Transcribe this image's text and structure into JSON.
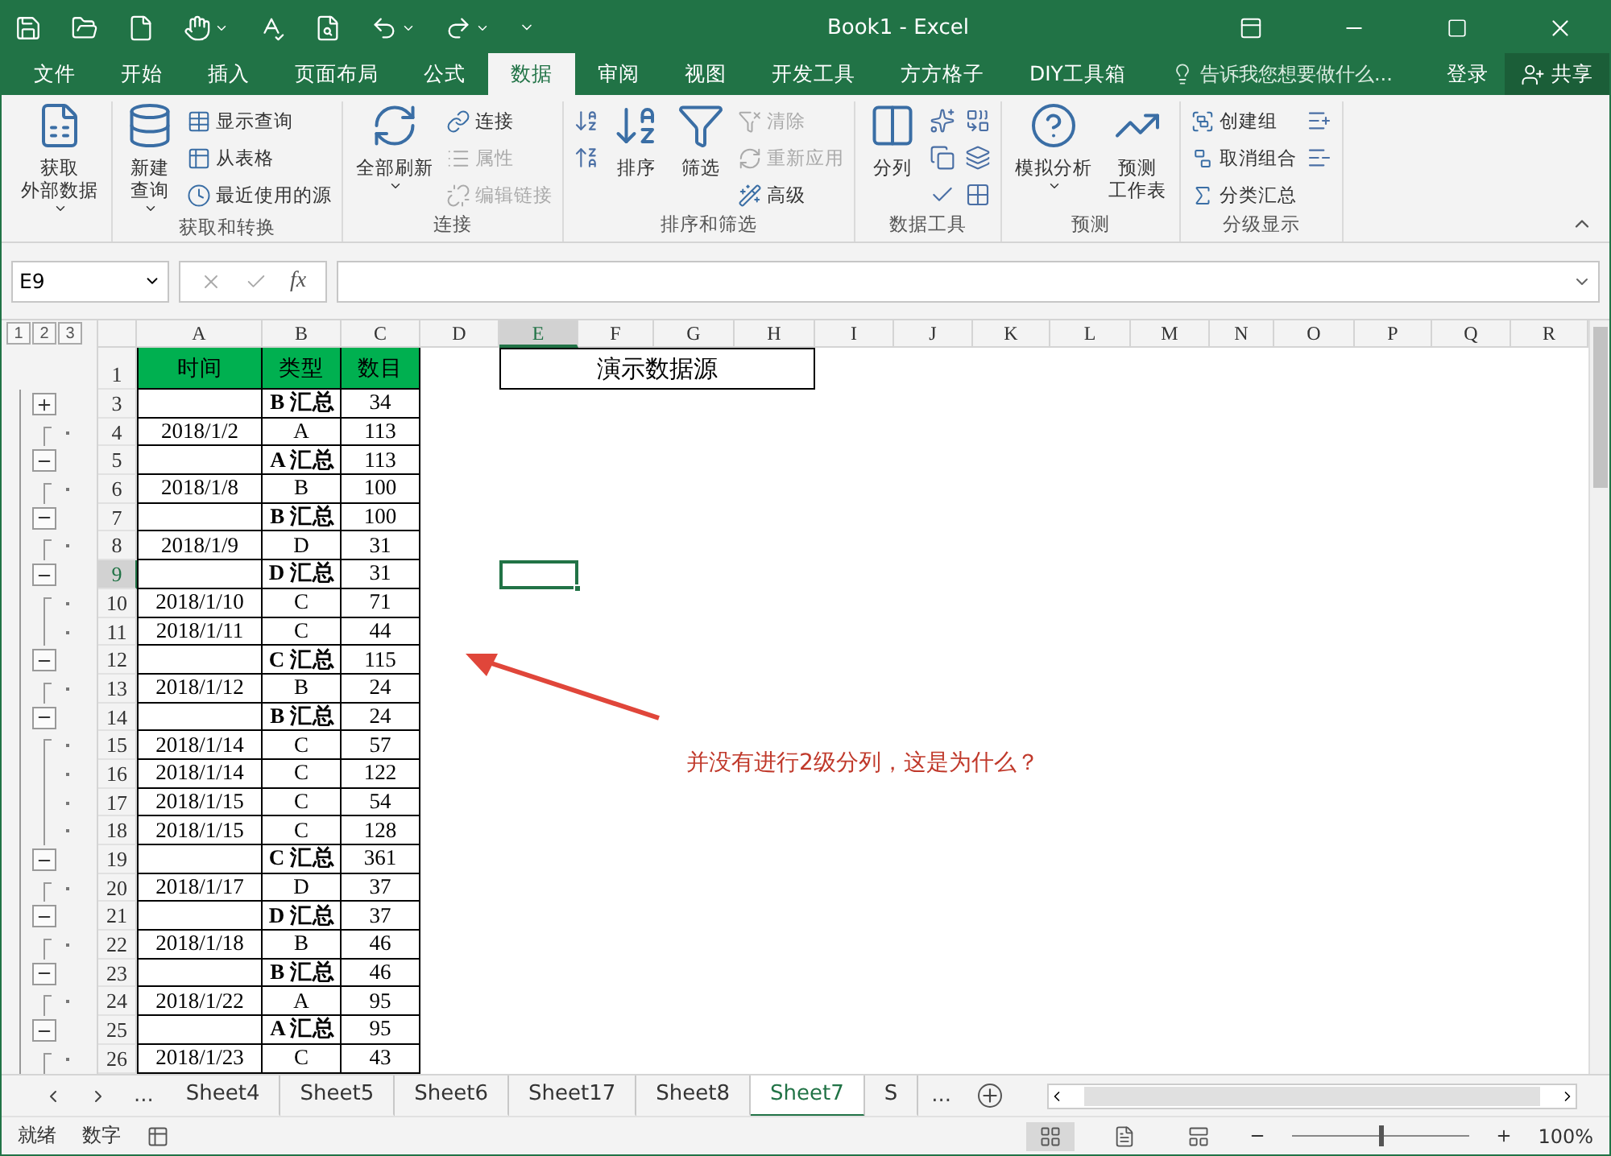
{
  "window": {
    "title": "Book1 - Excel"
  },
  "menu_tabs": [
    {
      "label": "文件",
      "selected": false
    },
    {
      "label": "开始",
      "selected": false
    },
    {
      "label": "插入",
      "selected": false
    },
    {
      "label": "页面布局",
      "selected": false
    },
    {
      "label": "公式",
      "selected": false
    },
    {
      "label": "数据",
      "selected": true
    },
    {
      "label": "审阅",
      "selected": false
    },
    {
      "label": "视图",
      "selected": false
    },
    {
      "label": "开发工具",
      "selected": false
    },
    {
      "label": "方方格子",
      "selected": false
    },
    {
      "label": "DIY工具箱",
      "selected": false
    }
  ],
  "tell_me": {
    "placeholder": "告诉我您想要做什么..."
  },
  "sign_in": "登录",
  "share": "共享",
  "ribbon_groups": [
    {
      "items": [
        {
          "kind": "large",
          "lines": [
            "获取",
            "外部数据"
          ],
          "dropdown": true,
          "disabled": false
        }
      ]
    },
    {
      "label": "获取和转换",
      "items": [
        {
          "kind": "large",
          "lines": [
            "新建",
            "查询"
          ],
          "dropdown": true,
          "disabled": false
        },
        {
          "kind": "small",
          "label": "显示查询",
          "disabled": false
        },
        {
          "kind": "small",
          "label": "从表格",
          "disabled": false
        },
        {
          "kind": "small",
          "label": "最近使用的源",
          "disabled": false
        }
      ]
    },
    {
      "label": "连接",
      "items": [
        {
          "kind": "large",
          "lines": [
            "全部刷新"
          ],
          "dropdown": true,
          "disabled": false
        },
        {
          "kind": "small",
          "label": "连接",
          "disabled": false
        },
        {
          "kind": "small",
          "label": "属性",
          "disabled": true
        },
        {
          "kind": "small",
          "label": "编辑链接",
          "disabled": true
        }
      ]
    },
    {
      "label": "排序和筛选",
      "items": [
        {
          "kind": "icons"
        },
        {
          "kind": "large",
          "lines": [
            "排序"
          ],
          "dropdown": false,
          "disabled": false
        },
        {
          "kind": "large",
          "lines": [
            "筛选"
          ],
          "dropdown": false,
          "disabled": false
        },
        {
          "kind": "small",
          "label": "清除",
          "disabled": true
        },
        {
          "kind": "small",
          "label": "重新应用",
          "disabled": true
        },
        {
          "kind": "small",
          "label": "高级",
          "disabled": false
        }
      ]
    },
    {
      "label": "数据工具",
      "items": [
        {
          "kind": "large",
          "lines": [
            "分列"
          ],
          "dropdown": false,
          "disabled": false
        },
        {
          "kind": "icons"
        },
        {
          "kind": "icons"
        }
      ]
    },
    {
      "label": "预测",
      "items": [
        {
          "kind": "large",
          "lines": [
            "模拟分析"
          ],
          "dropdown": true,
          "disabled": false
        },
        {
          "kind": "large",
          "lines": [
            "预测",
            "工作表"
          ],
          "dropdown": false,
          "disabled": false
        }
      ]
    },
    {
      "label": "分级显示",
      "items": [
        {
          "kind": "small",
          "label": "创建组",
          "disabled": false
        },
        {
          "kind": "small",
          "label": "取消组合",
          "disabled": false
        },
        {
          "kind": "small",
          "label": "分类汇总",
          "disabled": false
        },
        {
          "kind": "icons"
        }
      ]
    }
  ],
  "formula_bar": {
    "name_box": "E9",
    "fx": "fx"
  },
  "outline_levels": [
    "1",
    "2",
    "3"
  ],
  "columns": [
    {
      "label": "A",
      "selected": false
    },
    {
      "label": "B",
      "selected": false
    },
    {
      "label": "C",
      "selected": false
    },
    {
      "label": "D",
      "selected": false
    },
    {
      "label": "E",
      "selected": true
    },
    {
      "label": "F",
      "selected": false
    },
    {
      "label": "G",
      "selected": false
    },
    {
      "label": "H",
      "selected": false
    },
    {
      "label": "I",
      "selected": false
    },
    {
      "label": "J",
      "selected": false
    },
    {
      "label": "K",
      "selected": false
    },
    {
      "label": "L",
      "selected": false
    },
    {
      "label": "M",
      "selected": false
    },
    {
      "label": "N",
      "selected": false
    },
    {
      "label": "O",
      "selected": false
    },
    {
      "label": "P",
      "selected": false
    },
    {
      "label": "Q",
      "selected": false
    },
    {
      "label": "R",
      "selected": false
    }
  ],
  "header_row": {
    "n": "1",
    "cells": [
      "时间",
      "类型",
      "数目"
    ],
    "title_box": "演示数据源"
  },
  "rows": [
    {
      "n": "3",
      "kind": "subtotal",
      "expanded": false,
      "selected": false,
      "b": "B 汇总",
      "c": "34"
    },
    {
      "n": "4",
      "kind": "detail",
      "selected": false,
      "a": "2018/1/2",
      "b": "A",
      "c": "113"
    },
    {
      "n": "5",
      "kind": "subtotal",
      "expanded": true,
      "selected": false,
      "b": "A 汇总",
      "c": "113"
    },
    {
      "n": "6",
      "kind": "detail",
      "selected": false,
      "a": "2018/1/8",
      "b": "B",
      "c": "100"
    },
    {
      "n": "7",
      "kind": "subtotal",
      "expanded": true,
      "selected": false,
      "b": "B 汇总",
      "c": "100"
    },
    {
      "n": "8",
      "kind": "detail",
      "selected": false,
      "a": "2018/1/9",
      "b": "D",
      "c": "31"
    },
    {
      "n": "9",
      "kind": "subtotal",
      "expanded": true,
      "selected": true,
      "b": "D 汇总",
      "c": "31"
    },
    {
      "n": "10",
      "kind": "detail",
      "selected": false,
      "a": "2018/1/10",
      "b": "C",
      "c": "71"
    },
    {
      "n": "11",
      "kind": "detail",
      "selected": false,
      "a": "2018/1/11",
      "b": "C",
      "c": "44"
    },
    {
      "n": "12",
      "kind": "subtotal",
      "expanded": true,
      "selected": false,
      "b": "C 汇总",
      "c": "115"
    },
    {
      "n": "13",
      "kind": "detail",
      "selected": false,
      "a": "2018/1/12",
      "b": "B",
      "c": "24"
    },
    {
      "n": "14",
      "kind": "subtotal",
      "expanded": true,
      "selected": false,
      "b": "B 汇总",
      "c": "24"
    },
    {
      "n": "15",
      "kind": "detail",
      "selected": false,
      "a": "2018/1/14",
      "b": "C",
      "c": "57"
    },
    {
      "n": "16",
      "kind": "detail",
      "selected": false,
      "a": "2018/1/14",
      "b": "C",
      "c": "122"
    },
    {
      "n": "17",
      "kind": "detail",
      "selected": false,
      "a": "2018/1/15",
      "b": "C",
      "c": "54"
    },
    {
      "n": "18",
      "kind": "detail",
      "selected": false,
      "a": "2018/1/15",
      "b": "C",
      "c": "128"
    },
    {
      "n": "19",
      "kind": "subtotal",
      "expanded": true,
      "selected": false,
      "b": "C 汇总",
      "c": "361"
    },
    {
      "n": "20",
      "kind": "detail",
      "selected": false,
      "a": "2018/1/17",
      "b": "D",
      "c": "37"
    },
    {
      "n": "21",
      "kind": "subtotal",
      "expanded": true,
      "selected": false,
      "b": "D 汇总",
      "c": "37"
    },
    {
      "n": "22",
      "kind": "detail",
      "selected": false,
      "a": "2018/1/18",
      "b": "B",
      "c": "46"
    },
    {
      "n": "23",
      "kind": "subtotal",
      "expanded": true,
      "selected": false,
      "b": "B 汇总",
      "c": "46"
    },
    {
      "n": "24",
      "kind": "detail",
      "selected": false,
      "a": "2018/1/22",
      "b": "A",
      "c": "95"
    },
    {
      "n": "25",
      "kind": "subtotal",
      "expanded": true,
      "selected": false,
      "b": "A 汇总",
      "c": "95"
    },
    {
      "n": "26",
      "kind": "detail",
      "selected": false,
      "a": "2018/1/23",
      "b": "C",
      "c": "43"
    }
  ],
  "annotation": "并没有进行2级分列，这是为什么？",
  "sheet_tabs": {
    "more": "...",
    "tabs": [
      {
        "label": "Sheet4",
        "selected": false
      },
      {
        "label": "Sheet5",
        "selected": false
      },
      {
        "label": "Sheet6",
        "selected": false
      },
      {
        "label": "Sheet17",
        "selected": false
      },
      {
        "label": "Sheet8",
        "selected": false
      },
      {
        "label": "Sheet7",
        "selected": true
      },
      {
        "label": "S",
        "selected": false
      }
    ],
    "more_right": "..."
  },
  "status_bar": {
    "ready": "就绪",
    "mode": "数字",
    "zoom": "100%",
    "zoom_level": {
      "level": 0.5
    }
  }
}
